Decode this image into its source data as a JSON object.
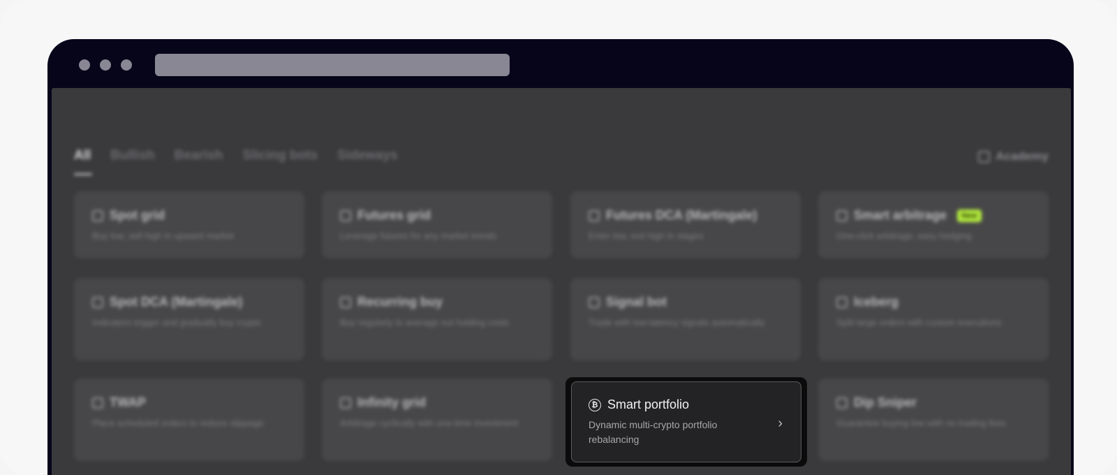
{
  "tabs": [
    {
      "label": "All",
      "active": true
    },
    {
      "label": "Bullish",
      "active": false
    },
    {
      "label": "Bearish",
      "active": false
    },
    {
      "label": "Slicing bots",
      "active": false
    },
    {
      "label": "Sideways",
      "active": false
    }
  ],
  "academy": {
    "label": "Academy",
    "icon": "book-icon"
  },
  "cards": [
    {
      "title": "Spot grid",
      "desc": "Buy low, sell high in upward market",
      "icon": "grid-icon"
    },
    {
      "title": "Futures grid",
      "desc": "Leverage futures for any market trends",
      "icon": "futures-icon"
    },
    {
      "title": "Futures DCA (Martingale)",
      "desc": "Enter low, exit high in stages",
      "icon": "dca-icon"
    },
    {
      "title": "Smart arbitrage",
      "desc": "One-click arbitrage, easy hedging",
      "icon": "arbitrage-icon",
      "badge": "New"
    },
    {
      "title": "Spot DCA (Martingale)",
      "desc": "Indicators trigger and gradually buy crypto",
      "icon": "dca-icon"
    },
    {
      "title": "Recurring buy",
      "desc": "Buy regularly to average out holding costs",
      "icon": "calendar-icon"
    },
    {
      "title": "Signal bot",
      "desc": "Trade with low-latency signals automatically",
      "icon": "signal-icon"
    },
    {
      "title": "Iceberg",
      "desc": "Split large orders with custom executions",
      "icon": "iceberg-icon"
    },
    {
      "title": "TWAP",
      "desc": "Place scheduled orders to reduce slippage",
      "icon": "clock-icon"
    },
    {
      "title": "Infinity grid",
      "desc": "Arbitrage cyclically with one-time investment",
      "icon": "infinity-icon"
    },
    {
      "title": "Dip Sniper",
      "desc": "Guarantee buying low with no trading fees",
      "icon": "sniper-icon"
    }
  ],
  "focused_card": {
    "title": "Smart portfolio",
    "desc": "Dynamic multi-crypto portfolio rebalancing",
    "icon": "bitcoin-coin-icon",
    "coin_glyph": "₿",
    "chevron": "›"
  },
  "colors": {
    "badge": "#b6ef3f",
    "window_chrome": "#07051a"
  }
}
